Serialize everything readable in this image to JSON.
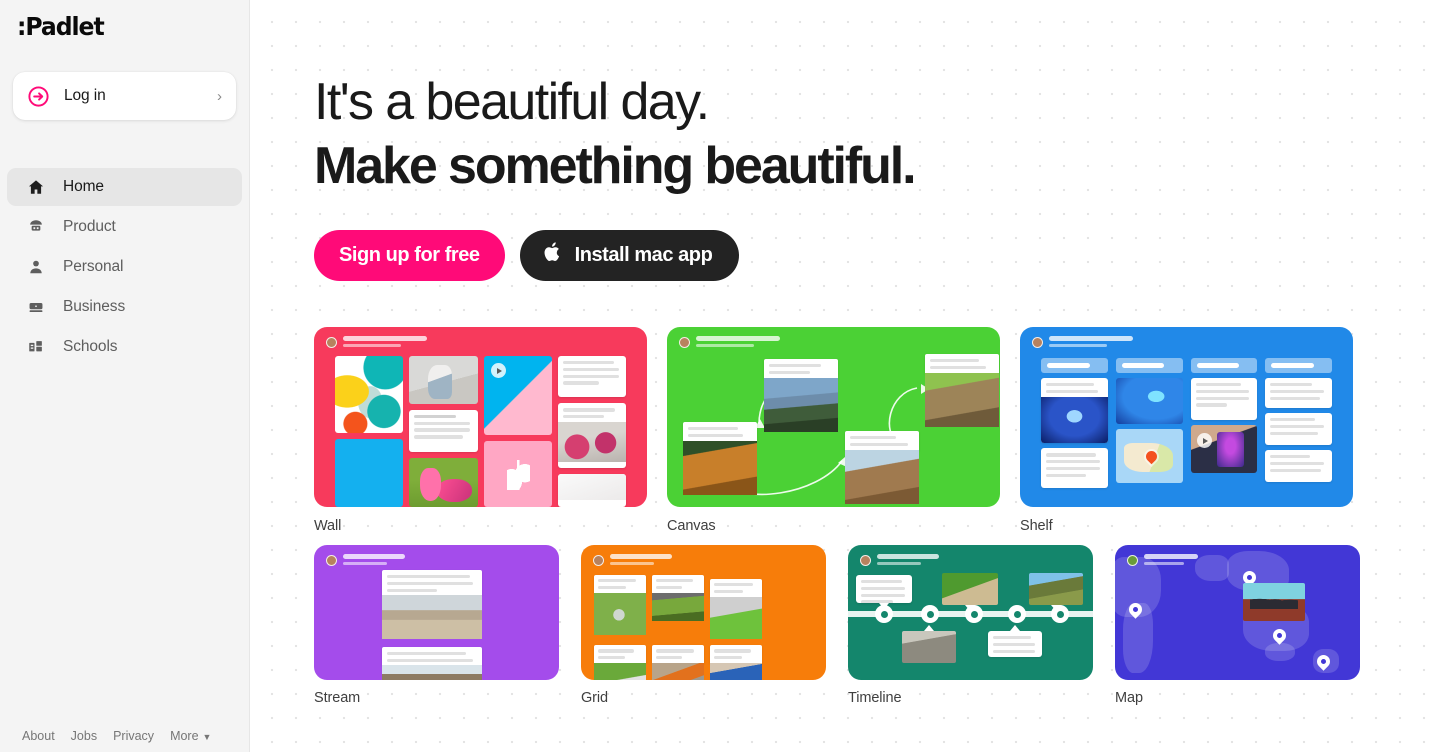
{
  "brand": {
    "logo_text": ":Padlet",
    "accent_pink": "#ff0a78",
    "dark": "#232323"
  },
  "sidebar": {
    "login": {
      "label": "Log in",
      "icon": "arrow-circle-right-icon",
      "chevron": "›"
    },
    "items": [
      {
        "label": "Home",
        "icon": "home-icon",
        "active": true
      },
      {
        "label": "Product",
        "icon": "lamp-icon",
        "active": false
      },
      {
        "label": "Personal",
        "icon": "person-icon",
        "active": false
      },
      {
        "label": "Business",
        "icon": "briefcase-icon",
        "active": false
      },
      {
        "label": "Schools",
        "icon": "school-icon",
        "active": false
      }
    ],
    "footer": {
      "links": [
        "About",
        "Jobs",
        "Privacy"
      ],
      "more_label": "More",
      "more_icon": "chevron-down-icon"
    }
  },
  "hero": {
    "line1": "It's a beautiful day.",
    "line2": "Make something beautiful."
  },
  "cta": {
    "signup_label": "Sign up for free",
    "mac_label": "Install mac app",
    "mac_icon": "apple-icon",
    "apple_glyph": ""
  },
  "templates": {
    "row1": [
      {
        "label": "Wall",
        "color": "#f73a5c"
      },
      {
        "label": "Canvas",
        "color": "#4bd135"
      },
      {
        "label": "Shelf",
        "color": "#2189e8"
      }
    ],
    "row2": [
      {
        "label": "Stream",
        "color": "#a44ceb"
      },
      {
        "label": "Grid",
        "color": "#f77d0a"
      },
      {
        "label": "Timeline",
        "color": "#14866c"
      },
      {
        "label": "Map",
        "color": "#4237d6"
      }
    ]
  }
}
